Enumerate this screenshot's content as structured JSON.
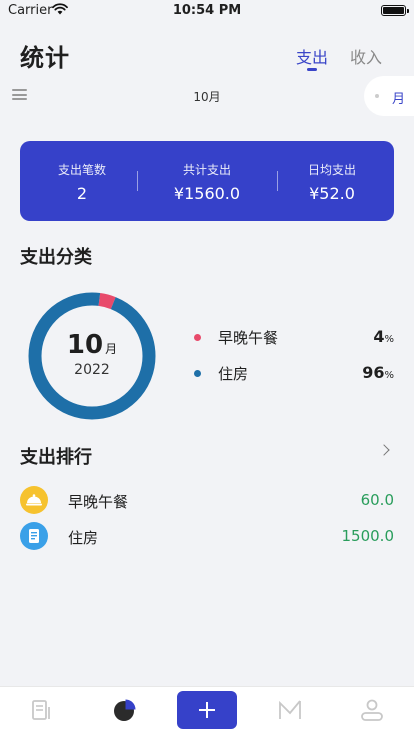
{
  "status_bar": {
    "carrier": "Carrier",
    "time": "10:54 PM"
  },
  "header": {
    "title": "统计",
    "tabs": [
      {
        "label": "支出",
        "active": true
      },
      {
        "label": "收入",
        "active": false
      }
    ]
  },
  "filter": {
    "month_label": "10月",
    "period": "月"
  },
  "summary": {
    "columns": [
      {
        "label": "支出笔数",
        "value": "2"
      },
      {
        "label": "共计支出",
        "value": "¥1560.0"
      },
      {
        "label": "日均支出",
        "value": "¥52.0"
      }
    ]
  },
  "category": {
    "title": "支出分类",
    "center_month": "10",
    "center_month_unit": "月",
    "center_year": "2022",
    "items": [
      {
        "name": "早晚午餐",
        "percent": "4",
        "unit": "%",
        "color": "#e84a6b"
      },
      {
        "name": "住房",
        "percent": "96",
        "unit": "%",
        "color": "#1e6fa8"
      }
    ]
  },
  "chart_data": {
    "type": "pie",
    "categories": [
      "早晚午餐",
      "住房"
    ],
    "values": [
      4,
      96
    ],
    "colors": [
      "#e84a6b",
      "#1e6fa8"
    ]
  },
  "ranking": {
    "title": "支出排行",
    "items": [
      {
        "name": "早晚午餐",
        "amount": "60.0",
        "icon": "meal-icon",
        "color": "#f6c22e"
      },
      {
        "name": "住房",
        "amount": "1500.0",
        "icon": "document-icon",
        "color": "#3aa0e8"
      }
    ]
  },
  "colors": {
    "accent": "#3641c9",
    "amount_green": "#2a9d5c"
  },
  "tab_bar": {
    "items": [
      {
        "icon": "ledger-icon"
      },
      {
        "icon": "pie-chart-icon"
      },
      {
        "icon": "add-icon"
      },
      {
        "icon": "trend-icon"
      },
      {
        "icon": "profile-icon"
      }
    ]
  }
}
